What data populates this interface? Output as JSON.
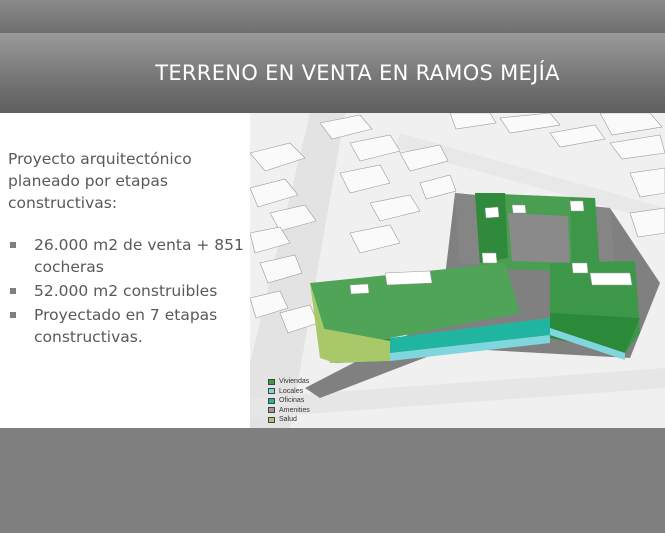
{
  "slide": {
    "title": "TERRENO EN VENTA EN RAMOS MEJÍA",
    "intro": "Proyecto arquitectónico planeado por etapas constructivas:",
    "bullets": [
      "26.000 m2 de venta + 851 cocheras",
      "52.000 m2 construibles",
      "Proyectado en 7 etapas constructivas."
    ]
  },
  "legend": [
    {
      "label": "Viviendas",
      "color": "#3e9b47"
    },
    {
      "label": "Locales",
      "color": "#7fd6dc"
    },
    {
      "label": "Oficinas",
      "color": "#1fb5a0"
    },
    {
      "label": "Amenities",
      "color": "#9a9a9a"
    },
    {
      "label": "Salud",
      "color": "#a8c86a"
    }
  ],
  "colors": {
    "background": "#7f7f7f",
    "title_text": "#ffffff",
    "body_text": "#595959"
  }
}
